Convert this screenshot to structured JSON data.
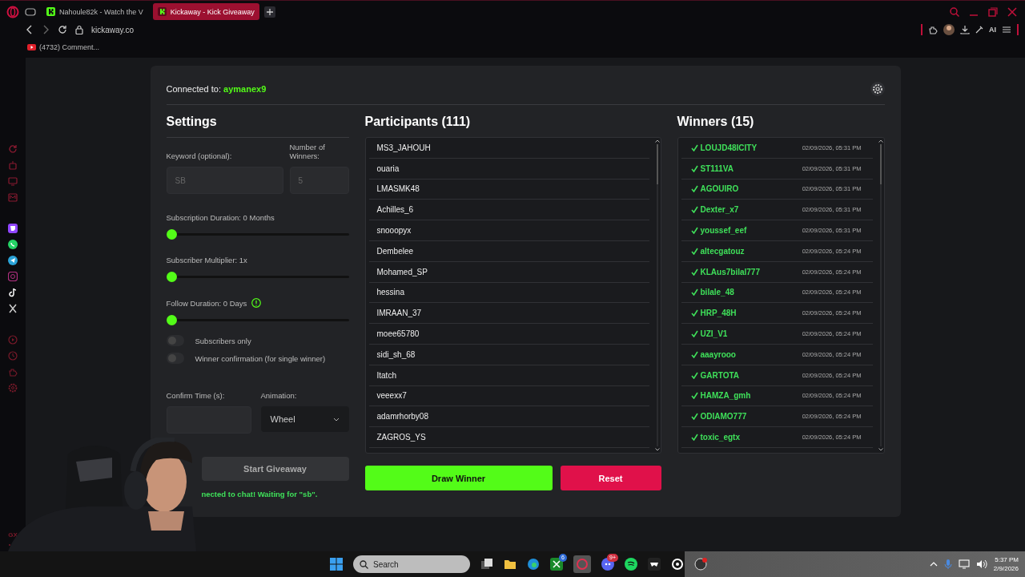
{
  "browser": {
    "tabs": [
      {
        "title": "Nahoule82k - Watch the V",
        "selected": false
      },
      {
        "title": "Kickaway - Kick Giveaway",
        "selected": true
      }
    ],
    "address": "kickaway.co",
    "toolbar_label": "AI",
    "bookmarks": [
      {
        "label": "(4732) Comment..."
      }
    ]
  },
  "sidebar": {
    "footer": "GX"
  },
  "header": {
    "prefix": "Connected to:",
    "channel": "aymanex9"
  },
  "settings": {
    "title": "Settings",
    "keyword": {
      "label": "Keyword (optional):",
      "placeholder": "SB"
    },
    "winners_count": {
      "label": "Number of Winners:",
      "placeholder": "5"
    },
    "sliders": [
      {
        "label": "Subscription Duration: 0 Months",
        "level": 0,
        "info": false
      },
      {
        "label": "Subscriber Multiplier: 1x",
        "level": 0,
        "info": false
      },
      {
        "label": "Follow Duration: 0 Days",
        "level": 0,
        "info": true
      }
    ],
    "toggles": [
      {
        "label": "Subscribers only",
        "on": false
      },
      {
        "label": "Winner confirmation (for single winner)",
        "on": false
      }
    ],
    "confirm_time": {
      "label": "Confirm Time (s):"
    },
    "animation": {
      "label": "Animation:",
      "value": "Wheel"
    },
    "start_button": "Start Giveaway",
    "status": "nected to chat! Waiting for \"sb\"."
  },
  "participants": {
    "title": "Participants (111)",
    "names": [
      "MS3_JAHOUH",
      "ouaria",
      "LMASMK48",
      "Achilles_6",
      "snooopyx",
      "Dembelee",
      "Mohamed_SP",
      "hessina",
      "IMRAAN_37",
      "moee65780",
      "sidi_sh_68",
      "Itatch",
      "veeexx7",
      "adamrhorby08",
      "ZAGROS_YS"
    ]
  },
  "winners": {
    "title": "Winners (15)",
    "rows": [
      {
        "name": "LOUJD48ICITY",
        "time": "02/09/2026, 05:31 PM"
      },
      {
        "name": "ST111VA",
        "time": "02/09/2026, 05:31 PM"
      },
      {
        "name": "AGOUIRO",
        "time": "02/09/2026, 05:31 PM"
      },
      {
        "name": "Dexter_x7",
        "time": "02/09/2026, 05:31 PM"
      },
      {
        "name": "youssef_eef",
        "time": "02/09/2026, 05:31 PM"
      },
      {
        "name": "altecgatouz",
        "time": "02/09/2026, 05:24 PM"
      },
      {
        "name": "KLAus7bilal777",
        "time": "02/09/2026, 05:24 PM"
      },
      {
        "name": "bilale_48",
        "time": "02/09/2026, 05:24 PM"
      },
      {
        "name": "HRP_48H",
        "time": "02/09/2026, 05:24 PM"
      },
      {
        "name": "UZI_V1",
        "time": "02/09/2026, 05:24 PM"
      },
      {
        "name": "aaayrooo",
        "time": "02/09/2026, 05:24 PM"
      },
      {
        "name": "GARTOTA",
        "time": "02/09/2026, 05:24 PM"
      },
      {
        "name": "HAMZA_gmh",
        "time": "02/09/2026, 05:24 PM"
      },
      {
        "name": "ODIAMO777",
        "time": "02/09/2026, 05:24 PM"
      },
      {
        "name": "toxic_egtx",
        "time": "02/09/2026, 05:24 PM"
      }
    ]
  },
  "buttons": {
    "draw": "Draw Winner",
    "reset": "Reset"
  },
  "taskbar": {
    "search": "Search",
    "xbox_badge": "6",
    "discord_badge": "9+",
    "time": "5:37 PM",
    "date": "2/9/2026"
  }
}
